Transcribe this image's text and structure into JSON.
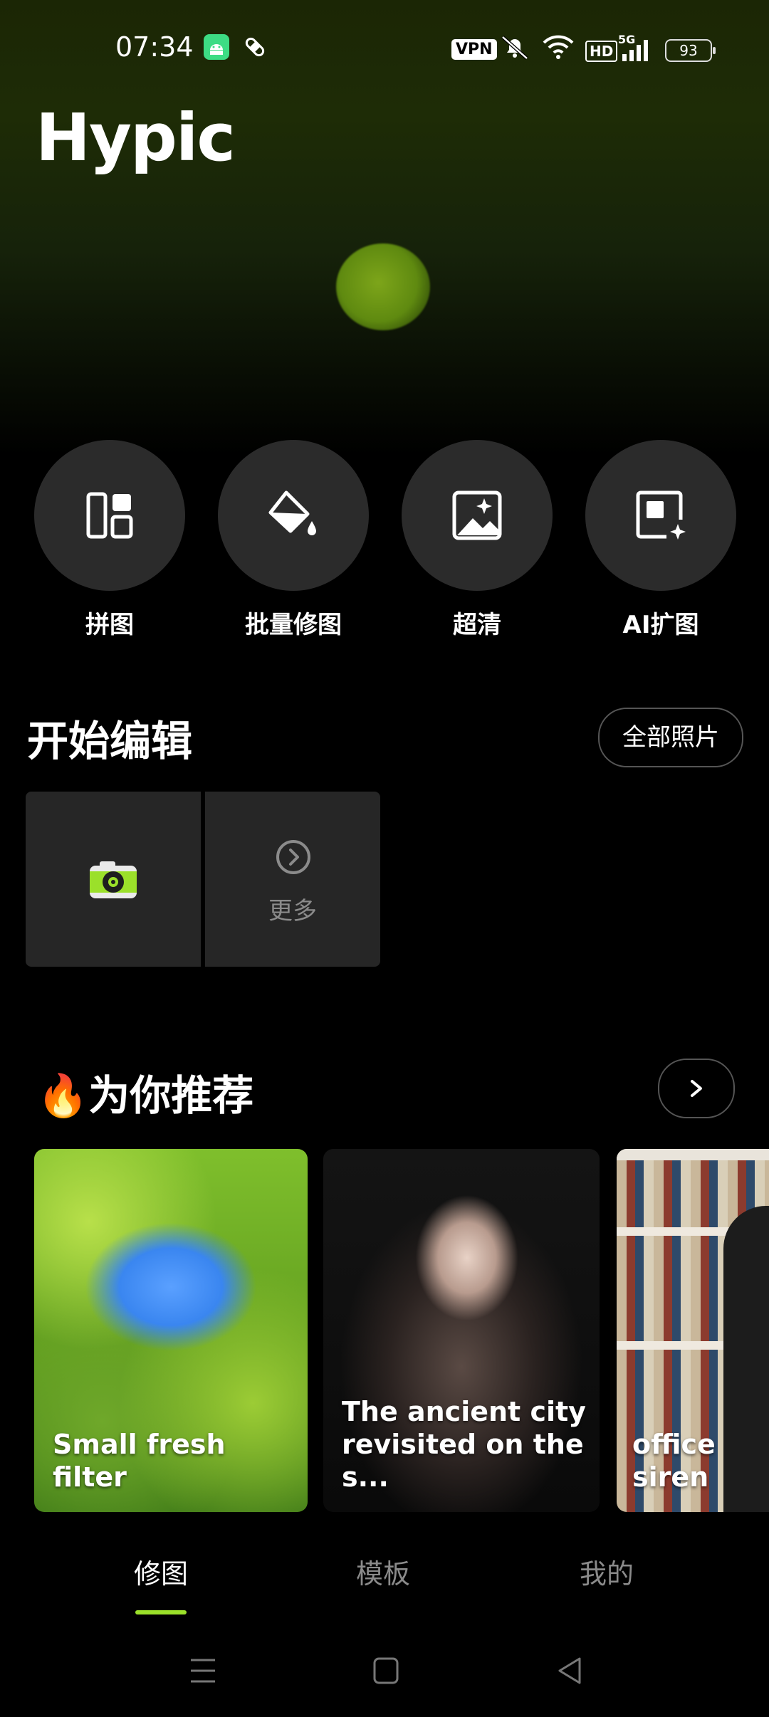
{
  "status_bar": {
    "time": "07:34",
    "vpn": "VPN",
    "hd": "HD",
    "network": "5G",
    "battery": "93",
    "icons": [
      "android-icon",
      "bandage-icon",
      "vpn-icon",
      "mute-icon",
      "wifi-icon",
      "hd-icon",
      "signal-icon",
      "battery-icon"
    ]
  },
  "app": {
    "title": "Hypic"
  },
  "tools": [
    {
      "label": "拼图",
      "icon": "collage-icon"
    },
    {
      "label": "批量修图",
      "icon": "paint-bucket-icon"
    },
    {
      "label": "超清",
      "icon": "enhance-image-icon"
    },
    {
      "label": "AI扩图",
      "icon": "ai-expand-icon"
    }
  ],
  "start_edit": {
    "title": "开始编辑",
    "all_photos": "全部照片",
    "more": "更多"
  },
  "recommend": {
    "title": "🔥为你推荐",
    "cards": [
      {
        "caption": "Small fresh filter"
      },
      {
        "caption": "The ancient city\nrevisited on the s..."
      },
      {
        "caption": "office siren"
      }
    ]
  },
  "bottom_tabs": [
    {
      "label": "修图",
      "active": true
    },
    {
      "label": "模板",
      "active": false
    },
    {
      "label": "我的",
      "active": false
    }
  ],
  "colors": {
    "accent": "#9be02a",
    "background": "#000000",
    "tile": "#262626"
  }
}
